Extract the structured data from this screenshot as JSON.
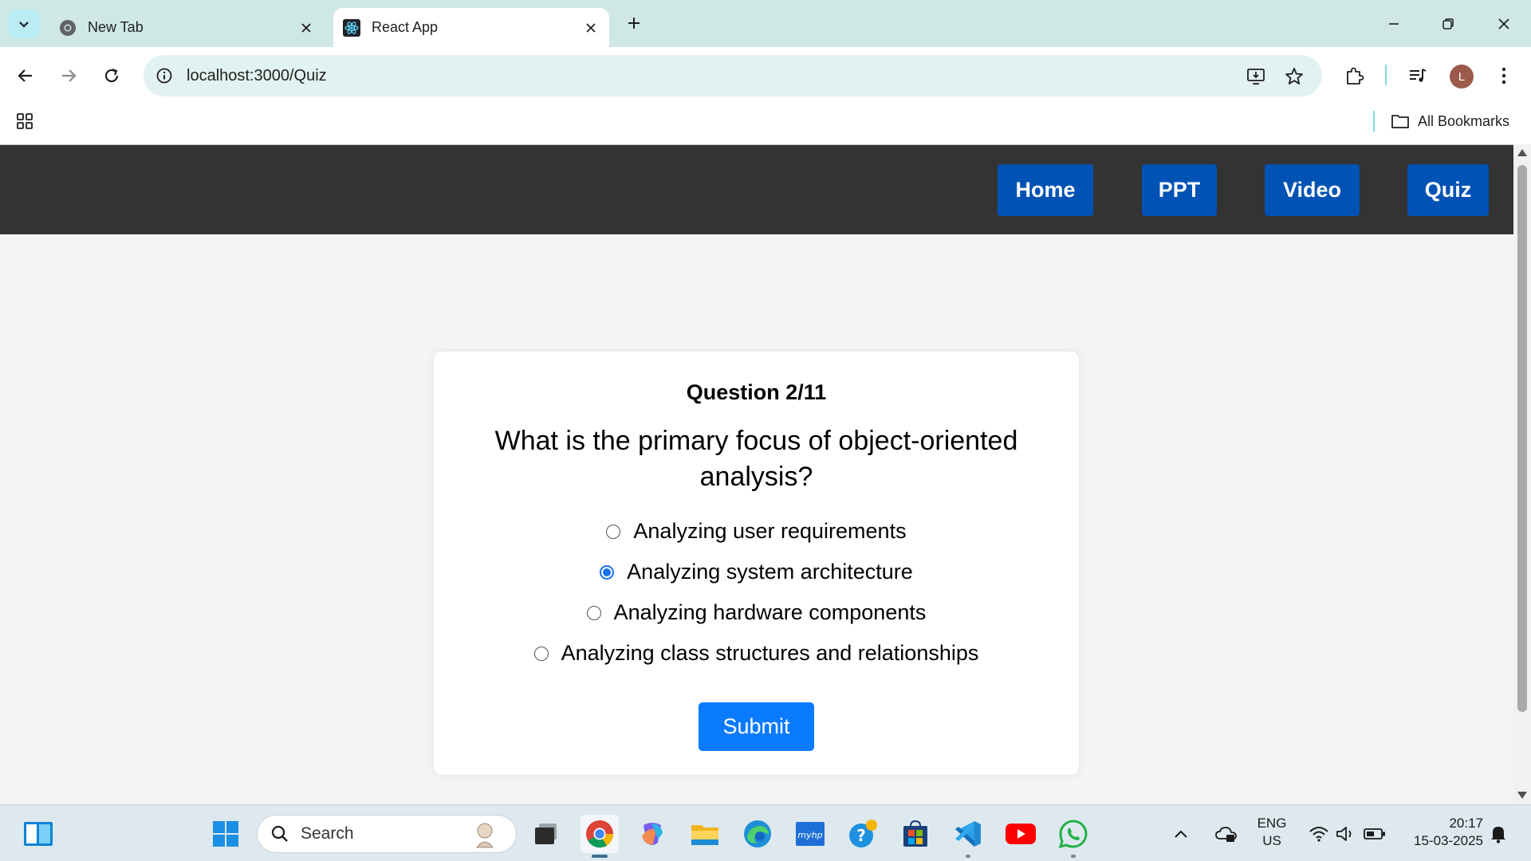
{
  "browser": {
    "tabs": [
      {
        "title": "New Tab",
        "active": false
      },
      {
        "title": "React App",
        "active": true
      }
    ],
    "url": "localhost:3000/Quiz",
    "profile_initial": "L",
    "bookmarks_label": "All Bookmarks"
  },
  "app": {
    "nav": [
      "Home",
      "PPT",
      "Video",
      "Quiz"
    ],
    "nav_color": "#0052b4",
    "header_bg": "#333333"
  },
  "quiz": {
    "counter": "Question 2/11",
    "question": "What is the primary focus of object-oriented analysis?",
    "options": [
      "Analyzing user requirements",
      "Analyzing system architecture",
      "Analyzing hardware components",
      "Analyzing class structures and relationships"
    ],
    "selected_index": 1,
    "submit_label": "Submit",
    "submit_color": "#0a7bff"
  },
  "taskbar": {
    "search_label": "Search",
    "language": "ENG",
    "region": "US",
    "time": "20:17",
    "date": "15-03-2025"
  }
}
